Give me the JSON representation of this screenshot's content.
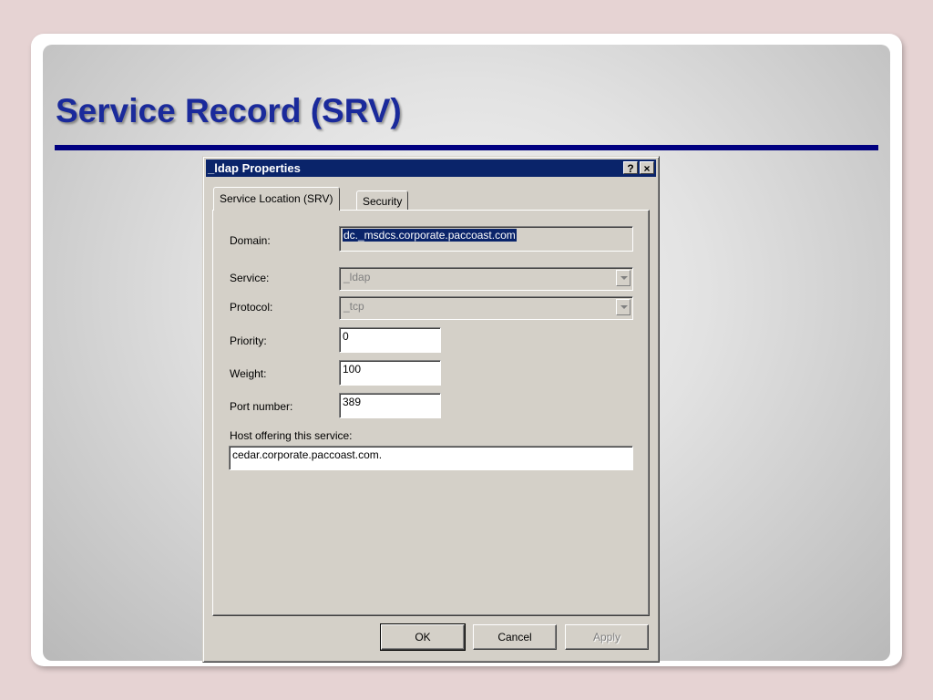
{
  "slide": {
    "title": "Service Record (SRV)"
  },
  "dialog": {
    "title": "_ldap Properties",
    "help_button": "?",
    "close_button": "×",
    "tabs": [
      {
        "label": "Service Location (SRV)",
        "active": true
      },
      {
        "label": "Security",
        "active": false
      }
    ],
    "fields": {
      "domain_label": "Domain:",
      "domain_value": "dc._msdcs.corporate.paccoast.com",
      "service_label": "Service:",
      "service_value": "_ldap",
      "protocol_label": "Protocol:",
      "protocol_value": "_tcp",
      "priority_label": "Priority:",
      "priority_value": "0",
      "weight_label": "Weight:",
      "weight_value": "100",
      "port_label": "Port number:",
      "port_value": "389",
      "host_label": "Host offering this service:",
      "host_value": "cedar.corporate.paccoast.com."
    },
    "buttons": {
      "ok": "OK",
      "cancel": "Cancel",
      "apply": "Apply"
    }
  },
  "colors": {
    "title_text": "#1a2a9b",
    "title_rule": "#000080",
    "titlebar": "#0a246a",
    "dialog_face": "#d4d0c8"
  }
}
